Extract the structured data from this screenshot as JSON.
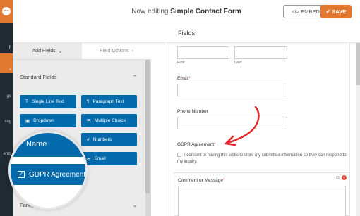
{
  "header": {
    "title_prefix": "Now editing",
    "form_name": "Simple Contact Form",
    "embed_label": "</> EMBED",
    "save_label": "✔ SAVE"
  },
  "sidebar": {
    "items": [
      {
        "label": "p"
      },
      {
        "label": "s"
      },
      {
        "label": "gs"
      },
      {
        "label": "ting"
      },
      {
        "label": "ents"
      }
    ]
  },
  "section_title": "Fields",
  "tabs": {
    "add_fields": "Add Fields",
    "field_options": "Field Options"
  },
  "standard_fields": {
    "heading": "Standard Fields",
    "buttons": [
      {
        "icon": "T",
        "label": "Single Line Text"
      },
      {
        "icon": "¶",
        "label": "Paragraph Text"
      },
      {
        "icon": "▣",
        "label": "Dropdown"
      },
      {
        "icon": "☰",
        "label": "Multiple Choice"
      },
      {
        "icon": "#",
        "label": "Numbers"
      },
      {
        "icon": "✉",
        "label": "Email"
      }
    ]
  },
  "fancy_heading": "Fancy",
  "magnifier": {
    "name_label": "Name",
    "gdpr_label": "GDPR Agreement"
  },
  "preview": {
    "first_label": "First",
    "last_label": "Last",
    "email_label": "Email",
    "phone_label": "Phone Number",
    "gdpr_label": "GDPR Agreement",
    "consent_text": "I consent to having this website store my submitted information so they can respond to my inquiry.",
    "comment_label": "Comment or Message",
    "required_mark": "*"
  },
  "colors": {
    "accent": "#e27730",
    "field_button": "#036aab",
    "rail": "#1f2a33",
    "arrow": "#e2282a"
  }
}
